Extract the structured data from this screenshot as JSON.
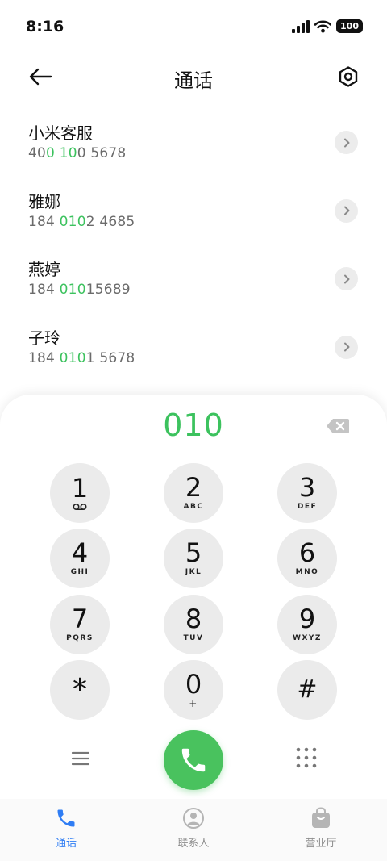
{
  "status_bar": {
    "time": "8:16",
    "battery": "100"
  },
  "header": {
    "title": "通话"
  },
  "contacts": [
    {
      "name": "小米客服",
      "number_parts": [
        "40",
        "0",
        " ",
        "10",
        "0 5678"
      ]
    },
    {
      "name": "雅娜",
      "number_parts": [
        "184 ",
        "010",
        "2 4685"
      ]
    },
    {
      "name": "燕婷",
      "number_parts": [
        "184 ",
        "010",
        "15689"
      ]
    },
    {
      "name": "子玲",
      "number_parts": [
        "184 ",
        "010",
        "1 5678"
      ]
    }
  ],
  "dialer": {
    "input": "010",
    "keys": [
      {
        "digit": "1",
        "letters": ""
      },
      {
        "digit": "2",
        "letters": "ABC"
      },
      {
        "digit": "3",
        "letters": "DEF"
      },
      {
        "digit": "4",
        "letters": "GHI"
      },
      {
        "digit": "5",
        "letters": "JKL"
      },
      {
        "digit": "6",
        "letters": "MNO"
      },
      {
        "digit": "7",
        "letters": "PQRS"
      },
      {
        "digit": "8",
        "letters": "TUV"
      },
      {
        "digit": "9",
        "letters": "WXYZ"
      },
      {
        "digit": "*",
        "letters": ""
      },
      {
        "digit": "0",
        "letters": "+"
      },
      {
        "digit": "#",
        "letters": ""
      }
    ]
  },
  "tabs": [
    {
      "label": "通话",
      "icon": "phone-icon",
      "active": true
    },
    {
      "label": "联系人",
      "icon": "contacts-icon",
      "active": false
    },
    {
      "label": "营业厅",
      "icon": "store-bag-icon",
      "active": false
    }
  ],
  "colors": {
    "accent_green": "#3cc25e",
    "call_green": "#49c25e",
    "tab_active": "#2f7df4"
  }
}
